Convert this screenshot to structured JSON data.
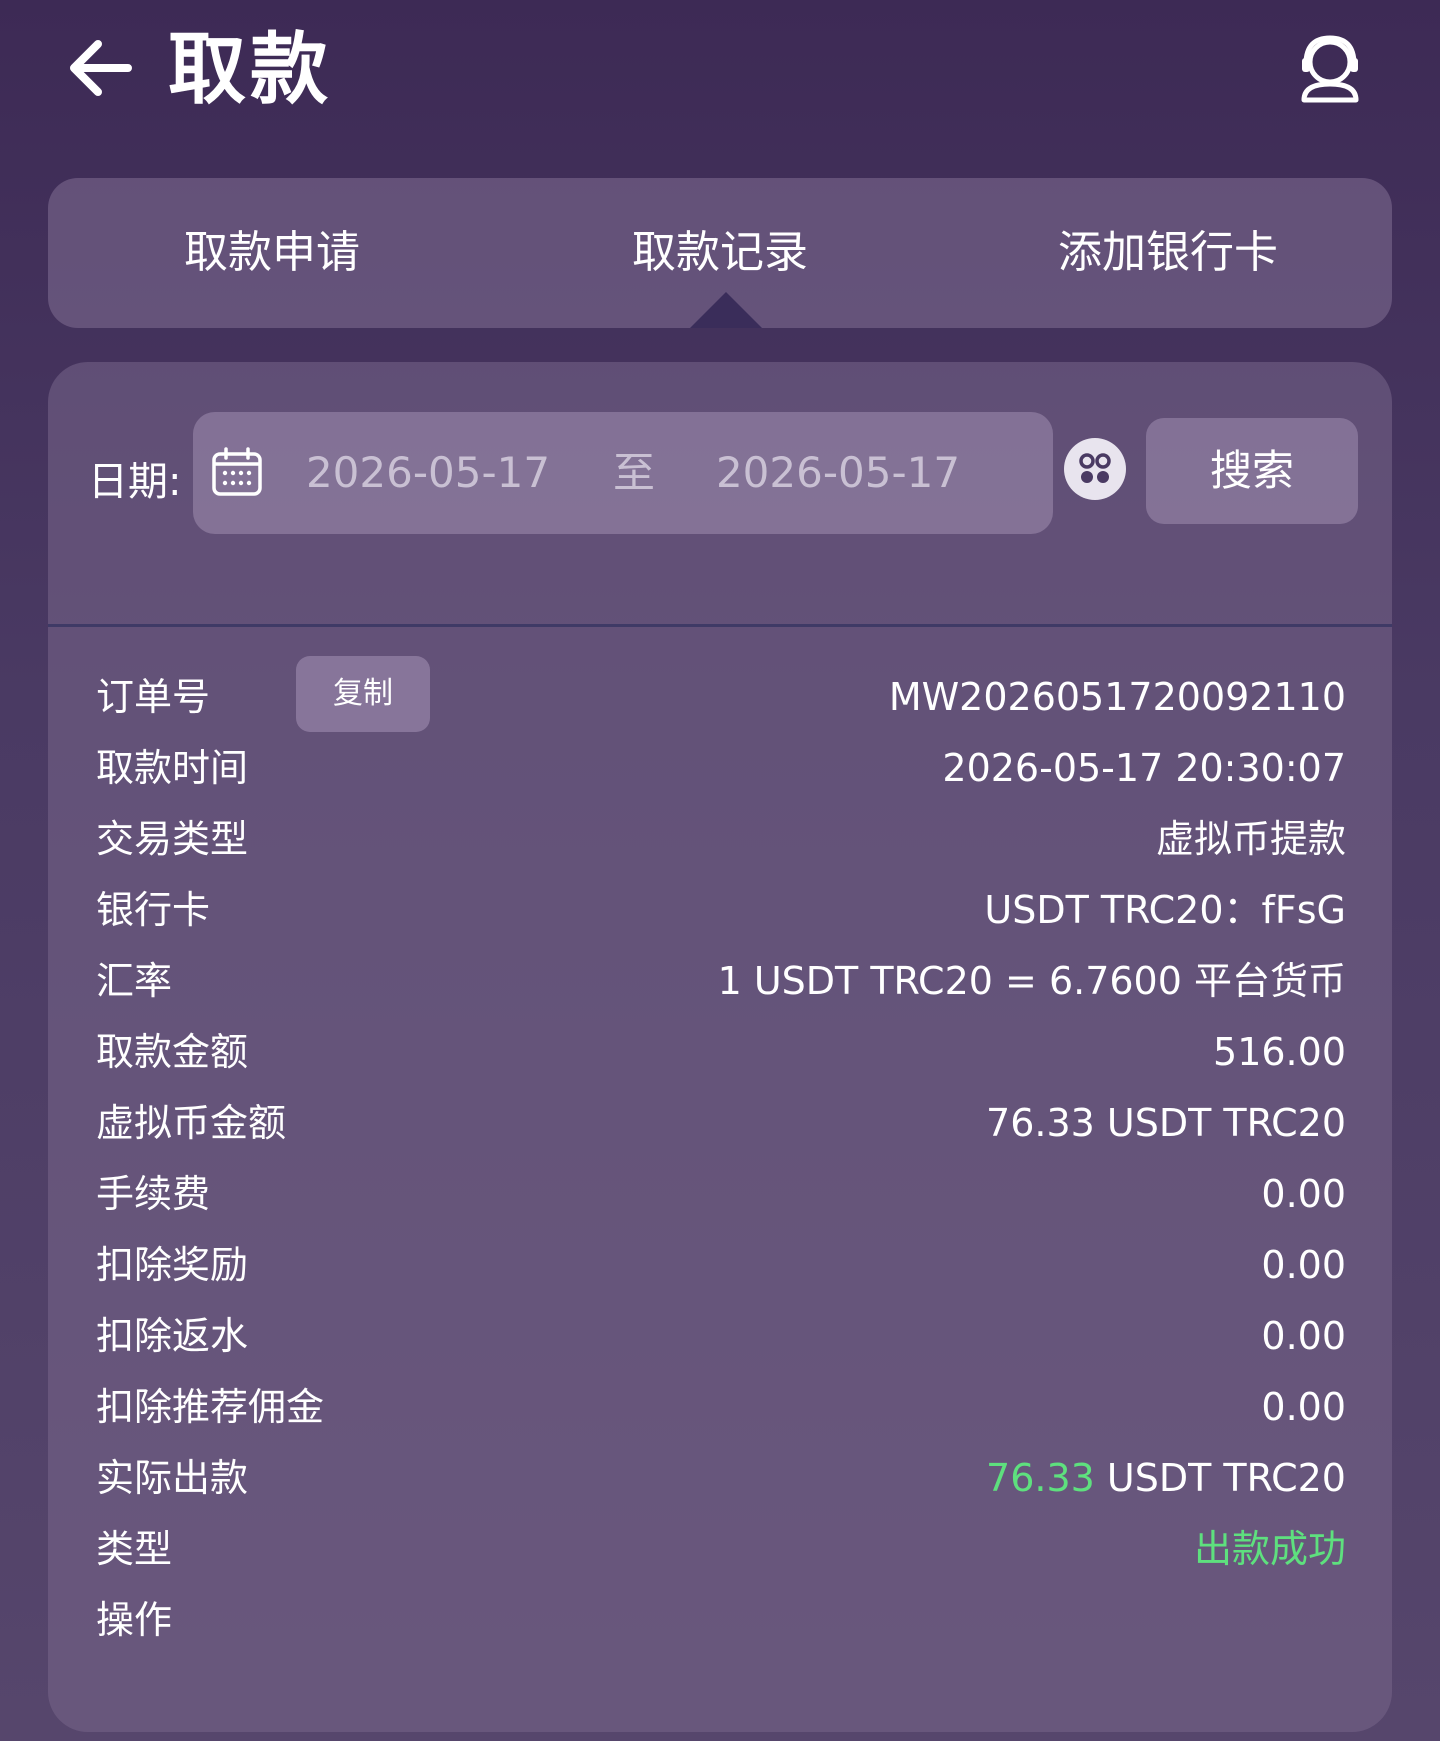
{
  "header": {
    "title": "取款",
    "back_icon": "arrow-left-icon",
    "support_icon": "customer-service-icon"
  },
  "tabs": [
    {
      "label": "取款申请"
    },
    {
      "label": "取款记录",
      "active": true
    },
    {
      "label": "添加银行卡"
    }
  ],
  "filter": {
    "date_label": "日期:",
    "start_date": "2026-05-17",
    "separator": "至",
    "end_date": "2026-05-17",
    "search_label": "搜索"
  },
  "record": {
    "order_label": "订单号",
    "copy_label": "复制",
    "order_value": "MW2026051720092110",
    "time_label": "取款时间",
    "time_value": "2026-05-17 20:30:07",
    "type_label": "交易类型",
    "type_value": "虚拟币提款",
    "card_label": "银行卡",
    "card_value": "USDT TRC20：fFsG",
    "rate_label": "汇率",
    "rate_value": "1 USDT TRC20 = 6.7600 平台货币",
    "amount_label": "取款金额",
    "amount_value": "516.00",
    "crypto_label": "虚拟币金额",
    "crypto_value": "76.33 USDT TRC20",
    "fee_label": "手续费",
    "fee_value": "0.00",
    "bonus_label": "扣除奖励",
    "bonus_value": "0.00",
    "rebate_label": "扣除返水",
    "rebate_value": "0.00",
    "commission_label": "扣除推荐佣金",
    "commission_value": "0.00",
    "actual_label": "实际出款",
    "actual_amount": "76.33",
    "actual_unit": " USDT TRC20",
    "status_label": "类型",
    "status_value": "出款成功",
    "action_label": "操作"
  },
  "colors": {
    "success": "#5ee07e",
    "background": "#4a3a63"
  }
}
